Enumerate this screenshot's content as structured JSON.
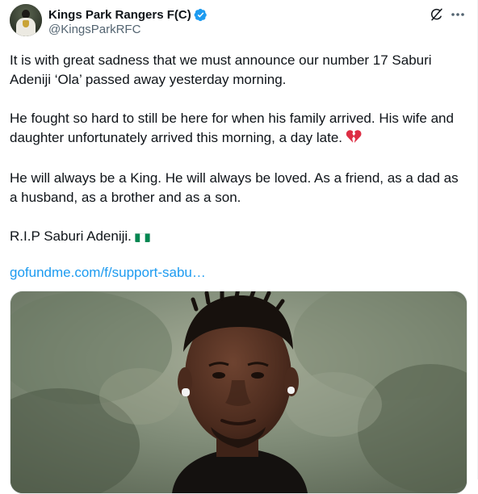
{
  "tweet": {
    "display_name": "Kings Park Rangers F(C)",
    "handle": "@KingsParkRFC",
    "verified": true,
    "paragraphs": [
      "It is with great sadness that we must announce our number 17 Saburi Adeniji ‘Ola’ passed away yesterday morning.",
      "He fought so hard to still be here for when his family arrived. His wife and daughter unfortunately arrived this morning, a day late.",
      "He will always be a King. He will always be loved. As a friend, as a dad as a husband, as a brother and as a son.",
      "R.I.P Saburi Adeniji."
    ],
    "link": "gofundme.com/f/support-sabu…",
    "icons": {
      "avatar": "club-avatar",
      "verified": "verified-badge-icon",
      "grok": "grok-icon",
      "more": "more-icon",
      "broken_heart": "broken-heart-emoji",
      "flag": "nigeria-flag-emoji"
    }
  },
  "colors": {
    "text": "#0f1419",
    "secondary": "#536471",
    "link": "#1d9bf0",
    "verified": "#1d9bf0"
  }
}
